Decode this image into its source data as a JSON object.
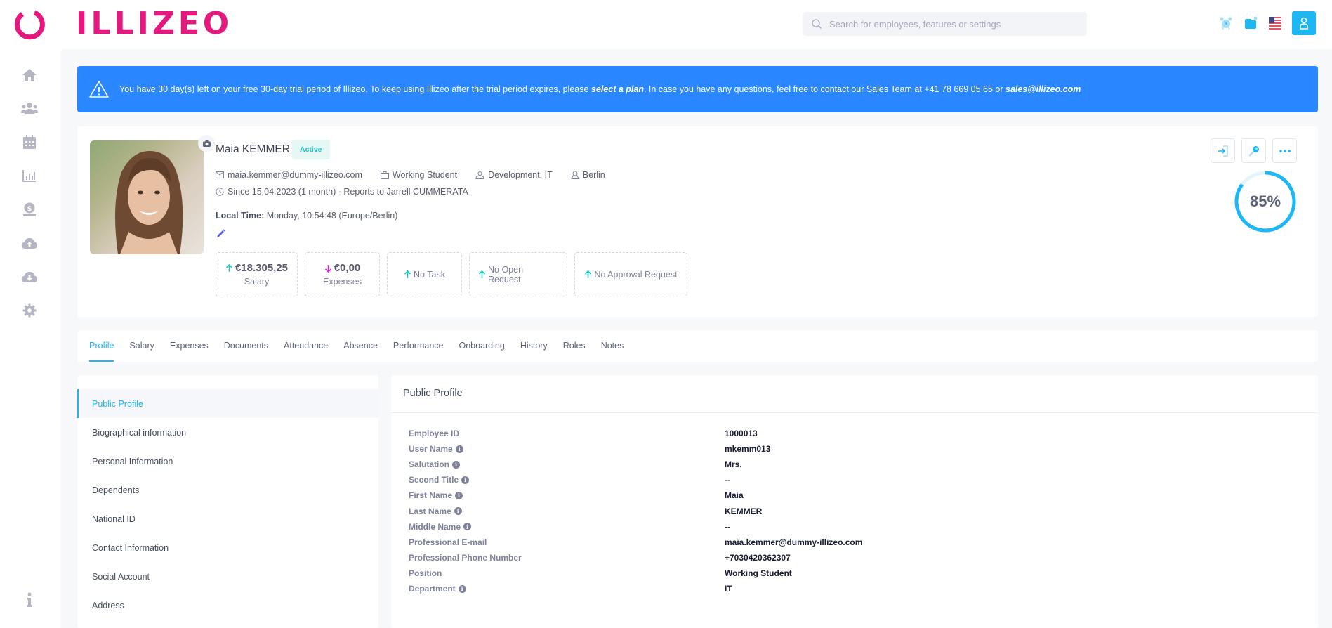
{
  "app": {
    "brand": "ILLIZEO"
  },
  "header": {
    "search_placeholder": "Search for employees, features or settings",
    "icons": [
      "alarm-clock-icon",
      "folder-notification-icon",
      "us-flag-icon",
      "user-icon"
    ]
  },
  "sidebar": {
    "items": [
      {
        "icon": "home-icon",
        "label": "Home"
      },
      {
        "icon": "users-icon",
        "label": "Employees"
      },
      {
        "icon": "calendar-icon",
        "label": "Calendar"
      },
      {
        "icon": "chart-icon",
        "label": "Reports"
      },
      {
        "icon": "money-icon",
        "label": "Payroll"
      },
      {
        "icon": "cloud-upload-icon",
        "label": "Upload"
      },
      {
        "icon": "cloud-download-icon",
        "label": "Download"
      },
      {
        "icon": "gear-icon",
        "label": "Settings"
      }
    ],
    "bottom_icon": "info-icon"
  },
  "banner": {
    "text_before": "You have 30 day(s) left on your free 30-day trial period of Illizeo. To keep using Illizeo after the trial period expires, please ",
    "link": "select a plan",
    "text_after": ". In case you have any questions, feel free to contact our Sales Team at +41 78 669 05 65 or ",
    "email": "sales@illizeo.com"
  },
  "profile": {
    "name": "Maia KEMMER",
    "status": "Active",
    "email": "maia.kemmer@dummy-illizeo.com",
    "position": "Working Student",
    "department": "Development, IT",
    "location": "Berlin",
    "since": "Since 15.04.2023 (1 month) · Reports to Jarrell CUMMERATA",
    "local_time_label": "Local Time:",
    "local_time_value": " Monday, 10:54:48 (Europe/Berlin)",
    "completion_percent": 85,
    "completion_label": "85%",
    "stats": {
      "salary": {
        "value": "€18.305,25",
        "label": "Salary",
        "trend": "up"
      },
      "expenses": {
        "value": "€0,00",
        "label": "Expenses",
        "trend": "down"
      },
      "task": "No Task",
      "open_request": "No Open Request",
      "approval_request": "No Approval Request"
    }
  },
  "tabs": [
    "Profile",
    "Salary",
    "Expenses",
    "Documents",
    "Attendance",
    "Absence",
    "Performance",
    "Onboarding",
    "History",
    "Roles",
    "Notes"
  ],
  "active_tab": "Profile",
  "sections": [
    "Public Profile",
    "Biographical information",
    "Personal Information",
    "Dependents",
    "National ID",
    "Contact Information",
    "Social Account",
    "Address"
  ],
  "public_profile": {
    "title": "Public Profile",
    "fields": [
      {
        "label": "Employee ID",
        "value": "1000013",
        "info": false
      },
      {
        "label": "User Name",
        "value": "mkemm013",
        "info": true
      },
      {
        "label": "Salutation",
        "value": "Mrs.",
        "info": true
      },
      {
        "label": "Second Title",
        "value": "--",
        "info": true
      },
      {
        "label": "First Name",
        "value": "Maia",
        "info": true
      },
      {
        "label": "Last Name",
        "value": "KEMMER",
        "info": true
      },
      {
        "label": "Middle Name",
        "value": "--",
        "info": true
      },
      {
        "label": "Professional E-mail",
        "value": "maia.kemmer@dummy-illizeo.com",
        "info": false
      },
      {
        "label": "Professional Phone Number",
        "value": "+7030420362307",
        "info": false
      },
      {
        "label": "Position",
        "value": "Working Student",
        "info": false
      },
      {
        "label": "Department",
        "value": "IT",
        "info": true
      }
    ]
  },
  "colors": {
    "brand": "#e5197d",
    "accent": "#1eb7f5",
    "banner": "#2b87ff",
    "success": "#1bc5bd",
    "danger": "#e91ee3"
  }
}
